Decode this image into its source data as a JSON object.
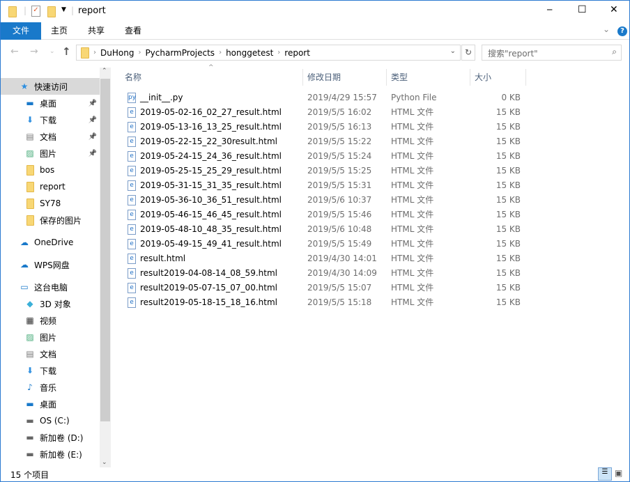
{
  "window": {
    "title": "report",
    "minimize": "─",
    "maximize": "☐",
    "close": "✕"
  },
  "ribbon": {
    "tabs": [
      "文件",
      "主页",
      "共享",
      "查看"
    ],
    "expand": "⌄",
    "help": "?"
  },
  "address": {
    "crumbs": [
      "DuHong",
      "PycharmProjects",
      "honggetest",
      "report"
    ],
    "search_placeholder": "搜索\"report\""
  },
  "nav": {
    "items": [
      {
        "label": "快速访问",
        "icon": "star-icon",
        "indent": 0,
        "pinned": false,
        "selected": true
      },
      {
        "label": "桌面",
        "icon": "desktop-icon",
        "indent": 1,
        "pinned": true
      },
      {
        "label": "下载",
        "icon": "download-icon",
        "indent": 1,
        "pinned": true
      },
      {
        "label": "文档",
        "icon": "document-icon",
        "indent": 1,
        "pinned": true
      },
      {
        "label": "图片",
        "icon": "pictures-icon",
        "indent": 1,
        "pinned": true
      },
      {
        "label": "bos",
        "icon": "folder-icon",
        "indent": 1
      },
      {
        "label": "report",
        "icon": "folder-icon",
        "indent": 1
      },
      {
        "label": "SY78",
        "icon": "folder-icon",
        "indent": 1
      },
      {
        "label": "保存的图片",
        "icon": "folder-icon",
        "indent": 1
      },
      {
        "label": "OneDrive",
        "icon": "cloud-icon",
        "indent": 0,
        "gap": true
      },
      {
        "label": "WPS网盘",
        "icon": "wps-cloud-icon",
        "indent": 0,
        "gap": true
      },
      {
        "label": "这台电脑",
        "icon": "computer-icon",
        "indent": 0,
        "gap": true
      },
      {
        "label": "3D 对象",
        "icon": "3d-icon",
        "indent": 1
      },
      {
        "label": "视频",
        "icon": "video-icon",
        "indent": 1
      },
      {
        "label": "图片",
        "icon": "pictures-icon",
        "indent": 1
      },
      {
        "label": "文档",
        "icon": "document-icon",
        "indent": 1
      },
      {
        "label": "下载",
        "icon": "download-icon",
        "indent": 1
      },
      {
        "label": "音乐",
        "icon": "music-icon",
        "indent": 1
      },
      {
        "label": "桌面",
        "icon": "desktop-icon",
        "indent": 1
      },
      {
        "label": "OS (C:)",
        "icon": "drive-icon",
        "indent": 1
      },
      {
        "label": "新加卷 (D:)",
        "icon": "drive-icon",
        "indent": 1
      },
      {
        "label": "新加卷 (E:)",
        "icon": "drive-icon",
        "indent": 1
      }
    ]
  },
  "columns": [
    "名称",
    "修改日期",
    "类型",
    "大小"
  ],
  "files": [
    {
      "name": "__init__.py",
      "date": "2019/4/29 15:57",
      "type": "Python File",
      "size": "0 KB",
      "icon": "python-file-icon"
    },
    {
      "name": "2019-05-02-16_02_27_result.html",
      "date": "2019/5/5 16:02",
      "type": "HTML 文件",
      "size": "15 KB",
      "icon": "html-file-icon"
    },
    {
      "name": "2019-05-13-16_13_25_result.html",
      "date": "2019/5/5 16:13",
      "type": "HTML 文件",
      "size": "15 KB",
      "icon": "html-file-icon"
    },
    {
      "name": "2019-05-22-15_22_30result.html",
      "date": "2019/5/5 15:22",
      "type": "HTML 文件",
      "size": "15 KB",
      "icon": "html-file-icon"
    },
    {
      "name": "2019-05-24-15_24_36_result.html",
      "date": "2019/5/5 15:24",
      "type": "HTML 文件",
      "size": "15 KB",
      "icon": "html-file-icon"
    },
    {
      "name": "2019-05-25-15_25_29_result.html",
      "date": "2019/5/5 15:25",
      "type": "HTML 文件",
      "size": "15 KB",
      "icon": "html-file-icon"
    },
    {
      "name": "2019-05-31-15_31_35_result.html",
      "date": "2019/5/5 15:31",
      "type": "HTML 文件",
      "size": "15 KB",
      "icon": "html-file-icon"
    },
    {
      "name": "2019-05-36-10_36_51_result.html",
      "date": "2019/5/6 10:37",
      "type": "HTML 文件",
      "size": "15 KB",
      "icon": "html-file-icon"
    },
    {
      "name": "2019-05-46-15_46_45_result.html",
      "date": "2019/5/5 15:46",
      "type": "HTML 文件",
      "size": "15 KB",
      "icon": "html-file-icon"
    },
    {
      "name": "2019-05-48-10_48_35_result.html",
      "date": "2019/5/6 10:48",
      "type": "HTML 文件",
      "size": "15 KB",
      "icon": "html-file-icon"
    },
    {
      "name": "2019-05-49-15_49_41_result.html",
      "date": "2019/5/5 15:49",
      "type": "HTML 文件",
      "size": "15 KB",
      "icon": "html-file-icon"
    },
    {
      "name": "result.html",
      "date": "2019/4/30 14:01",
      "type": "HTML 文件",
      "size": "15 KB",
      "icon": "html-file-icon"
    },
    {
      "name": "result2019-04-08-14_08_59.html",
      "date": "2019/4/30 14:09",
      "type": "HTML 文件",
      "size": "15 KB",
      "icon": "html-file-icon"
    },
    {
      "name": "result2019-05-07-15_07_00.html",
      "date": "2019/5/5 15:07",
      "type": "HTML 文件",
      "size": "15 KB",
      "icon": "html-file-icon"
    },
    {
      "name": "result2019-05-18-15_18_16.html",
      "date": "2019/5/5 15:18",
      "type": "HTML 文件",
      "size": "15 KB",
      "icon": "html-file-icon"
    }
  ],
  "status": {
    "count": "15 个项目"
  },
  "colors": {
    "accent": "#1979ca",
    "selected_nav": "#d9d9d9"
  }
}
